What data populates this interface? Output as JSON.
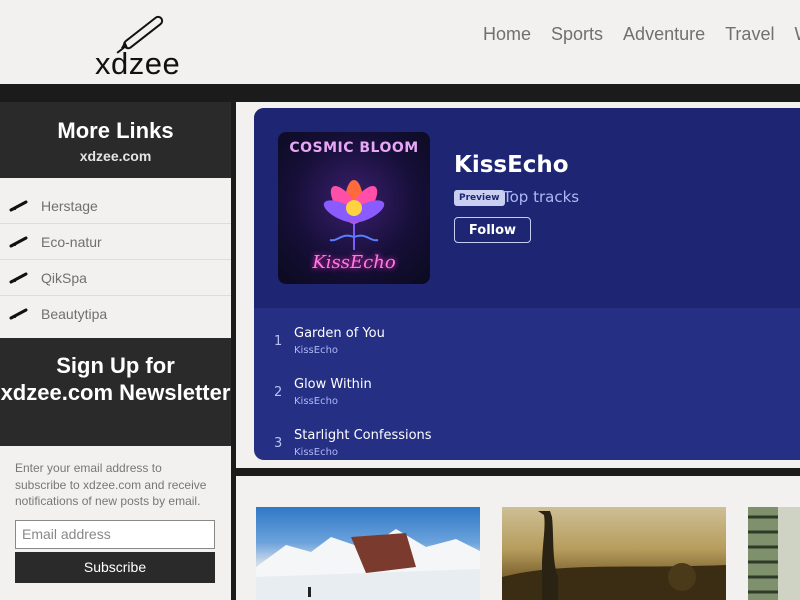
{
  "header": {
    "logo_text": "xdzee",
    "nav": [
      "Home",
      "Sports",
      "Adventure",
      "Travel",
      "W"
    ]
  },
  "sidebar": {
    "links_title": "More Links",
    "links_subtitle": "xdzee.com",
    "links": [
      "Herstage",
      "Eco-natur",
      "QikSpa",
      "Beautytipa"
    ],
    "signup_title": "Sign Up for xdzee.com Newsletter",
    "signup_text": "Enter your email address to subscribe to xdzee.com and receive notifications of new posts by email.",
    "email_placeholder": "Email address",
    "subscribe_label": "Subscribe"
  },
  "player": {
    "cover_title": "COSMIC BLOOM",
    "cover_signature": "KissEcho",
    "artist": "KissEcho",
    "badge": "Preview",
    "subtitle": "Top tracks",
    "follow_label": "Follow",
    "tracks": [
      {
        "num": "1",
        "name": "Garden of You",
        "artist": "KissEcho"
      },
      {
        "num": "2",
        "name": "Glow Within",
        "artist": "KissEcho"
      },
      {
        "num": "3",
        "name": "Starlight Confessions",
        "artist": "KissEcho"
      }
    ],
    "colors": {
      "embed_bg": "#252f84",
      "embed_top": "#1e2673",
      "accent_text": "#aeb8f5"
    }
  },
  "thumbnails": [
    "snowy-mountain-photo",
    "giraffe-sunset-photo",
    "vertical-garden-building-photo"
  ]
}
